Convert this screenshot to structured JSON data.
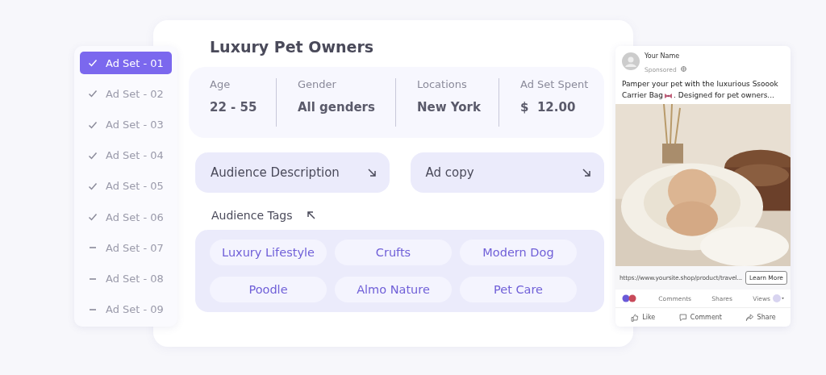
{
  "ad_sets": [
    {
      "label": "Ad Set - 01",
      "checked": true,
      "selected": true
    },
    {
      "label": "Ad Set - 02",
      "checked": true,
      "selected": false
    },
    {
      "label": "Ad Set - 03",
      "checked": true,
      "selected": false
    },
    {
      "label": "Ad Set - 04",
      "checked": true,
      "selected": false
    },
    {
      "label": "Ad Set - 05",
      "checked": true,
      "selected": false
    },
    {
      "label": "Ad Set - 06",
      "checked": true,
      "selected": false
    },
    {
      "label": "Ad Set - 07",
      "checked": false,
      "selected": false
    },
    {
      "label": "Ad Set - 08",
      "checked": false,
      "selected": false
    },
    {
      "label": "Ad Set - 09",
      "checked": false,
      "selected": false
    }
  ],
  "audience": {
    "title": "Luxury Pet Owners",
    "stats": [
      {
        "label": "Age",
        "value": "22 - 55"
      },
      {
        "label": "Gender",
        "value": "All genders"
      },
      {
        "label": "Locations",
        "value": "New York"
      },
      {
        "label": "Ad Set Spent",
        "value": "$  12.00"
      }
    ],
    "sections": [
      {
        "label": "Audience Description"
      },
      {
        "label": "Ad copy"
      }
    ],
    "tags_title": "Audience Tags",
    "tags": [
      "Luxury Lifestyle",
      "Crufts",
      "Modern Dog",
      "Poodle",
      "Almo Nature",
      "Pet Care"
    ]
  },
  "ad_preview": {
    "name": "Your Name",
    "sponsored": "Sponsored",
    "text_line1": "Pamper your pet with the luxurious Ssoook",
    "text_before": "Carrier Bag",
    "text_after": ". Designed for pet owners...",
    "image": {
      "kind": "picture"
    },
    "url": "https://www.yoursite.shop/product/travel...",
    "cta": "Learn More",
    "stats": [
      "Comments",
      "Shares",
      "Views"
    ],
    "actions": [
      "Like",
      "Comment",
      "Share"
    ]
  }
}
